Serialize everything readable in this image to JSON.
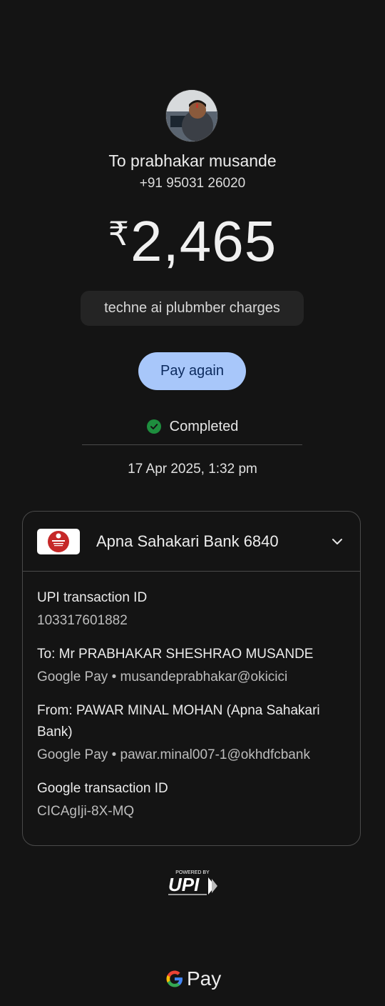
{
  "recipient": {
    "name": "To prabhakar musande",
    "phone": "+91 95031 26020"
  },
  "amount": {
    "currency": "₹",
    "value": "2,465"
  },
  "note": "techne ai plubmber charges",
  "actions": {
    "pay_again": "Pay again"
  },
  "status": {
    "label": "Completed",
    "color": "#1e8e3e"
  },
  "datetime": "17 Apr 2025, 1:32 pm",
  "account": {
    "bank_name": "Apna Sahakari Bank 6840",
    "details": [
      {
        "label": "UPI transaction ID",
        "value": "103317601882"
      },
      {
        "label": "To: Mr PRABHAKAR SHESHRAO MUSANDE",
        "value": "Google Pay • musandeprabhakar@okicici"
      },
      {
        "label": "From: PAWAR MINAL MOHAN (Apna Sahakari Bank)",
        "value": "Google Pay • pawar.minal007-1@okhdfcbank"
      },
      {
        "label": "Google transaction ID",
        "value": "CICAgIji-8X-MQ"
      }
    ]
  },
  "footer": {
    "upi_powered_by": "POWERED BY",
    "upi_word": "UPI",
    "gpay_label": "Pay"
  },
  "colors": {
    "background": "#141414",
    "accent_button": "#a8c7fa",
    "success": "#1e8e3e"
  }
}
